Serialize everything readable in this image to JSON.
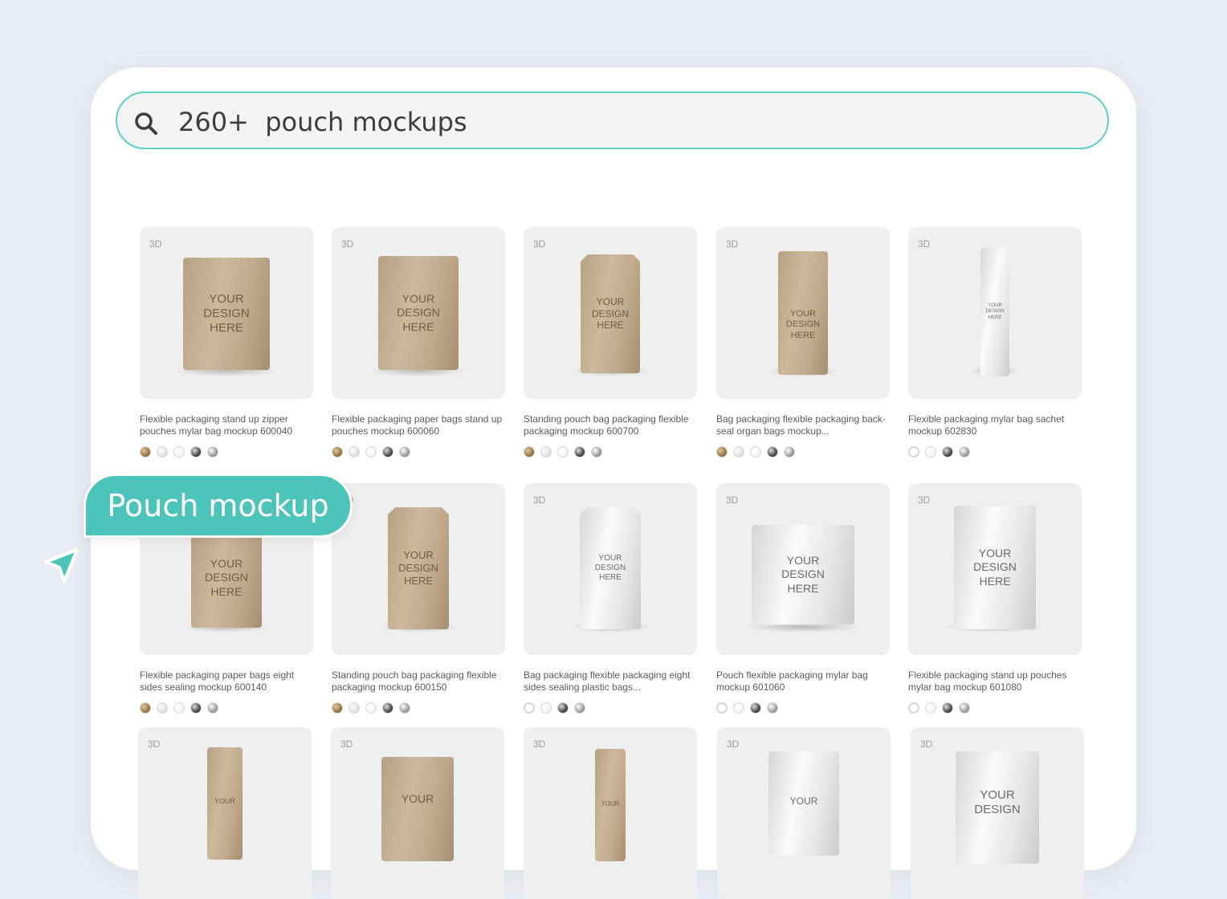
{
  "search": {
    "count": "260+",
    "query": "pouch mockups"
  },
  "badge_3d": "3D",
  "mock_text": [
    "YOUR",
    "DESIGN",
    "HERE"
  ],
  "products": [
    {
      "title": "Flexible packaging stand up zipper pouches mylar bag mockup 600040",
      "swatches": [
        "gold",
        "pearl",
        "white",
        "dark",
        "silver"
      ]
    },
    {
      "title": "Flexible packaging paper bags stand up pouches mockup 600060",
      "swatches": [
        "gold",
        "pearl",
        "white",
        "dark",
        "silver"
      ]
    },
    {
      "title": "Standing pouch bag packaging flexible packaging mockup 600700",
      "swatches": [
        "gold",
        "pearl",
        "white",
        "dark",
        "silver"
      ]
    },
    {
      "title": "Bag packaging flexible packaging back-seal organ bags mockup...",
      "swatches": [
        "gold",
        "pearl",
        "white",
        "dark",
        "silver"
      ]
    },
    {
      "title": "Flexible packaging mylar bag sachet mockup 602830",
      "swatches": [
        "ring",
        "white",
        "dark",
        "silver"
      ]
    },
    {
      "title": "Flexible packaging paper bags eight sides sealing mockup 600140",
      "swatches": [
        "gold",
        "pearl",
        "white",
        "dark",
        "silver"
      ]
    },
    {
      "title": "Standing pouch bag packaging flexible packaging mockup 600150",
      "swatches": [
        "gold",
        "pearl",
        "white",
        "dark",
        "silver"
      ]
    },
    {
      "title": "Bag packaging flexible packaging eight sides sealing plastic bags...",
      "swatches": [
        "ring",
        "white",
        "dark",
        "silver"
      ]
    },
    {
      "title": "Pouch flexible packaging mylar bag mockup 601060",
      "swatches": [
        "ring",
        "white",
        "dark",
        "silver"
      ]
    },
    {
      "title": "Flexible packaging stand up pouches mylar bag mockup 601080",
      "swatches": [
        "ring",
        "white",
        "dark",
        "silver"
      ]
    }
  ],
  "callout": {
    "label": "Pouch mockup"
  },
  "colors": {
    "accent": "#4cc4ba",
    "search_border": "#5ccfc7",
    "background": "#e9ecf4"
  },
  "icons": {
    "search": "search-icon",
    "cursor": "cursor-arrow-icon"
  }
}
